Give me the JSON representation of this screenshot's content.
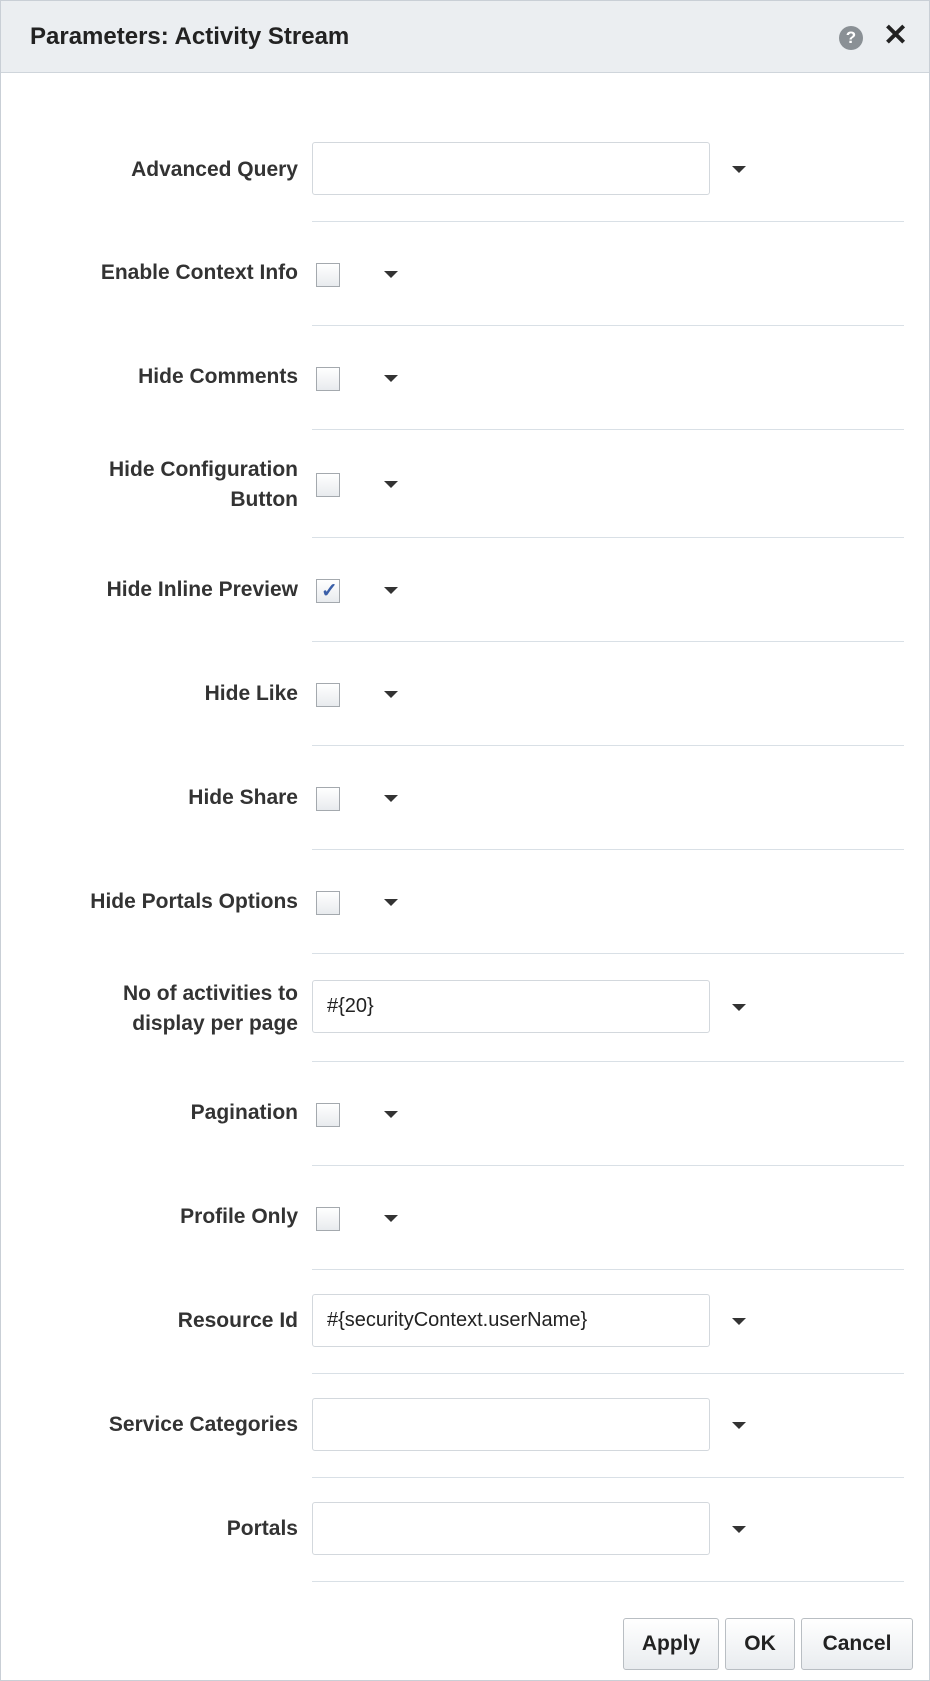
{
  "dialog": {
    "title": "Parameters: Activity Stream",
    "help_icon": "?",
    "close_icon": "✕"
  },
  "fields": [
    {
      "label": "Advanced Query",
      "type": "text",
      "value": ""
    },
    {
      "label": "Enable Context Info",
      "type": "checkbox",
      "checked": false
    },
    {
      "label": "Hide Comments",
      "type": "checkbox",
      "checked": false
    },
    {
      "label": "Hide Configuration",
      "label2": "Button",
      "type": "checkbox",
      "checked": false
    },
    {
      "label": "Hide Inline Preview",
      "type": "checkbox",
      "checked": true
    },
    {
      "label": "Hide Like",
      "type": "checkbox",
      "checked": false
    },
    {
      "label": "Hide Share",
      "type": "checkbox",
      "checked": false
    },
    {
      "label": "Hide Portals Options",
      "type": "checkbox",
      "checked": false
    },
    {
      "label": "No of activities to",
      "label2": "display per page",
      "type": "text",
      "value": "#{20}"
    },
    {
      "label": "Pagination",
      "type": "checkbox",
      "checked": false
    },
    {
      "label": "Profile Only",
      "type": "checkbox",
      "checked": false
    },
    {
      "label": "Resource Id",
      "type": "text",
      "value": "#{securityContext.userName}"
    },
    {
      "label": "Service Categories",
      "type": "text",
      "value": ""
    },
    {
      "label": "Portals",
      "type": "text",
      "value": ""
    }
  ],
  "buttons": {
    "apply": "Apply",
    "ok": "OK",
    "cancel": "Cancel"
  }
}
